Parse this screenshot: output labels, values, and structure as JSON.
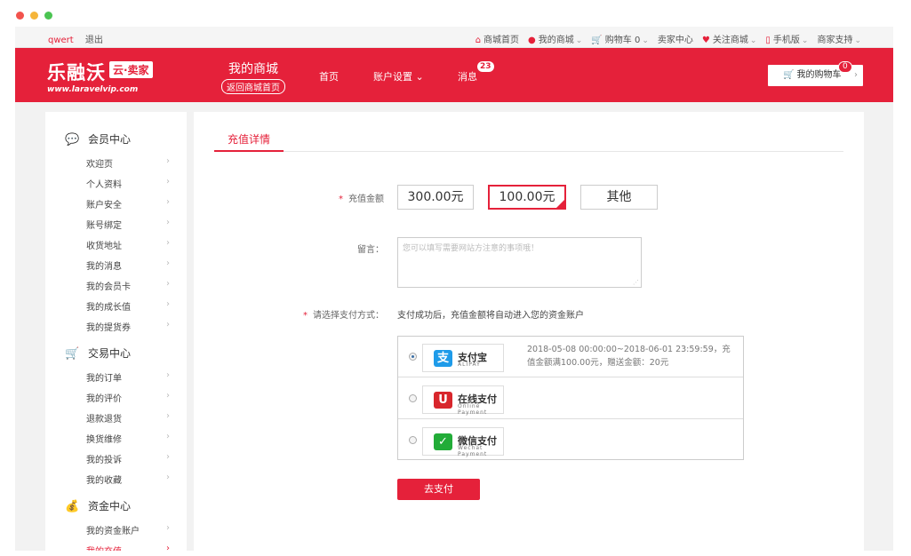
{
  "topbar": {
    "username": "qwert",
    "logout": "退出",
    "links": [
      {
        "label": "商城首页",
        "icon": "home-icon",
        "glyph": "⌂",
        "caret": false
      },
      {
        "label": "我的商城",
        "icon": "user-icon",
        "glyph": "●",
        "caret": true
      },
      {
        "label": "购物车 0",
        "icon": "cart-icon",
        "glyph": "🛒",
        "caret": true
      },
      {
        "label": "卖家中心",
        "icon": "",
        "glyph": "",
        "caret": false
      },
      {
        "label": "关注商城",
        "icon": "heart-icon",
        "glyph": "♥",
        "caret": true
      },
      {
        "label": "手机版",
        "icon": "phone-icon",
        "glyph": "▯",
        "caret": true
      },
      {
        "label": "商家支持",
        "icon": "",
        "glyph": "",
        "caret": true
      }
    ]
  },
  "header": {
    "logo_text": "乐融沃",
    "logo_badge": "云·卖家",
    "logo_url": "www.laravelvip.com",
    "mymall_title": "我的商城",
    "mymall_back": "返回商城首页",
    "nav": [
      "首页",
      "账户设置",
      "消息"
    ],
    "message_count": "23",
    "cart_label": "我的购物车",
    "cart_count": "0"
  },
  "sidebar": {
    "sections": [
      {
        "title": "会员中心",
        "icon": "chat-bubble-icon",
        "items": [
          "欢迎页",
          "个人资料",
          "账户安全",
          "账号绑定",
          "收货地址",
          "我的消息",
          "我的会员卡",
          "我的成长值",
          "我的提货券"
        ]
      },
      {
        "title": "交易中心",
        "icon": "cart-icon",
        "items": [
          "我的订单",
          "我的评价",
          "退款退货",
          "换货维修",
          "我的投诉",
          "我的收藏"
        ]
      },
      {
        "title": "资金中心",
        "icon": "money-bag-icon",
        "items": [
          "我的资金账户",
          "我的充值"
        ]
      }
    ],
    "active_item": "我的充值"
  },
  "main": {
    "tab": "充值详情",
    "amount_label": "充值金额",
    "amounts": [
      "300.00元",
      "100.00元",
      "其他"
    ],
    "selected_amount": "100.00元",
    "memo_label": "留言：",
    "memo_placeholder": "您可以填写需要网站方注意的事项哦！",
    "pay_method_label": "请选择支付方式：",
    "pay_note": "支付成功后，充值金额将自动进入您的资金账户",
    "payments": [
      {
        "name": "支付宝",
        "sub": "ALIPAY",
        "icon": "alipay-icon",
        "color": "#1e9be9",
        "glyph": "支",
        "selected": true,
        "desc": "2018-05-08 00:00:00~2018-06-01 23:59:59，充值金额满100.00元，赠送金额：20元"
      },
      {
        "name": "在线支付",
        "sub": "Online Payment",
        "icon": "unionpay-icon",
        "color": "#d8262c",
        "glyph": "U",
        "selected": false,
        "desc": ""
      },
      {
        "name": "微信支付",
        "sub": "Wechat Payment",
        "icon": "wechat-pay-icon",
        "color": "#22ac38",
        "glyph": "✓",
        "selected": false,
        "desc": ""
      }
    ],
    "submit": "去支付"
  },
  "colors": {
    "brand": "#e5213a"
  }
}
